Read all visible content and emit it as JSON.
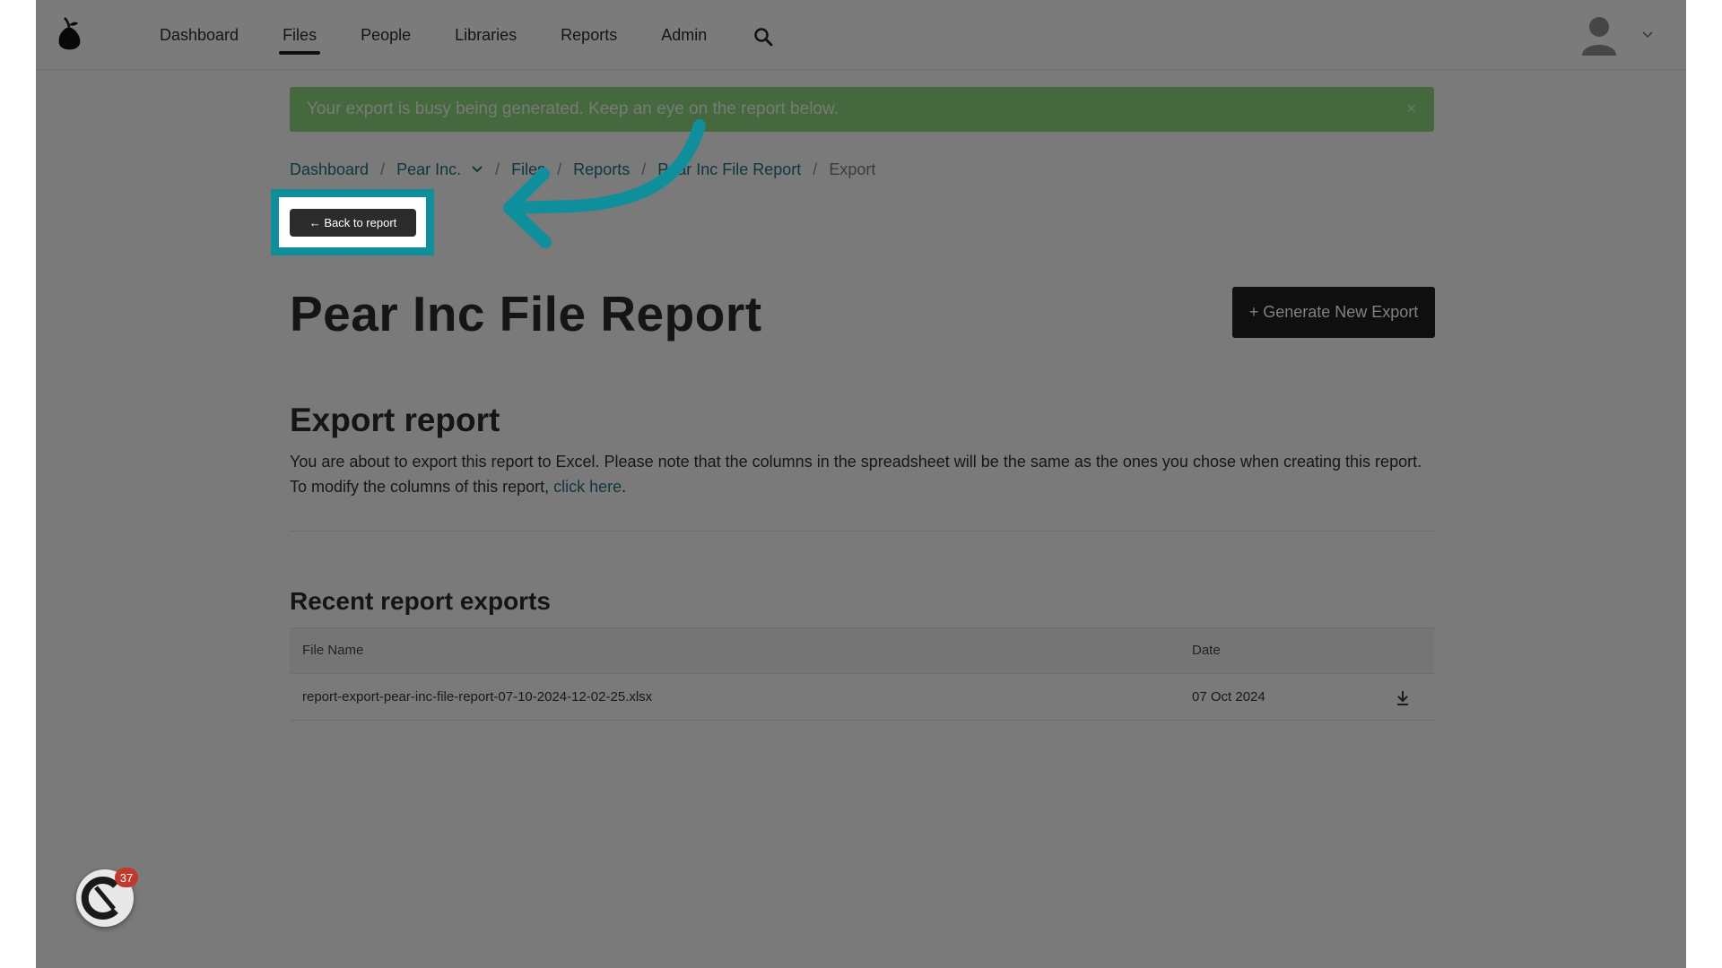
{
  "nav": {
    "items": [
      {
        "label": "Dashboard",
        "active": false
      },
      {
        "label": "Files",
        "active": true
      },
      {
        "label": "People",
        "active": false
      },
      {
        "label": "Libraries",
        "active": false
      },
      {
        "label": "Reports",
        "active": false
      },
      {
        "label": "Admin",
        "active": false
      }
    ],
    "search_icon": "search-icon",
    "user_menu_icon": "avatar-icon"
  },
  "alert": {
    "message": "Your export is busy being generated. Keep an eye on the report below.",
    "close_label": "×",
    "color": "#8ad07c"
  },
  "breadcrumb": {
    "items": [
      "Dashboard",
      "Pear Inc.",
      "Files",
      "Reports",
      "Pear Inc File Report",
      "Export"
    ],
    "separator": "/"
  },
  "back_button": {
    "label": "← Back to report"
  },
  "page": {
    "title": "Pear Inc File Report",
    "generate_button": "+ Generate New Export"
  },
  "export_section": {
    "title": "Export report",
    "description_1": "You are about to export this report to Excel. Please note that the columns in the spreadsheet will be the same as the ones you chose when creating this report.",
    "description_2_prefix": "To modify the columns of this report, ",
    "description_link": "click here",
    "description_2_suffix": "."
  },
  "recent_exports": {
    "title": "Recent report exports",
    "columns": [
      "File Name",
      "Date"
    ],
    "rows": [
      {
        "file_name": "report-export-pear-inc-file-report-07-10-2024-12-02-25.xlsx",
        "date": "07 Oct 2024"
      }
    ]
  },
  "widget": {
    "badge_count": "37"
  },
  "colors": {
    "accent": "#1f6f7b",
    "highlight": "#0f8f9b",
    "dark_button": "#1f1f1f",
    "badge": "#c0392b"
  }
}
